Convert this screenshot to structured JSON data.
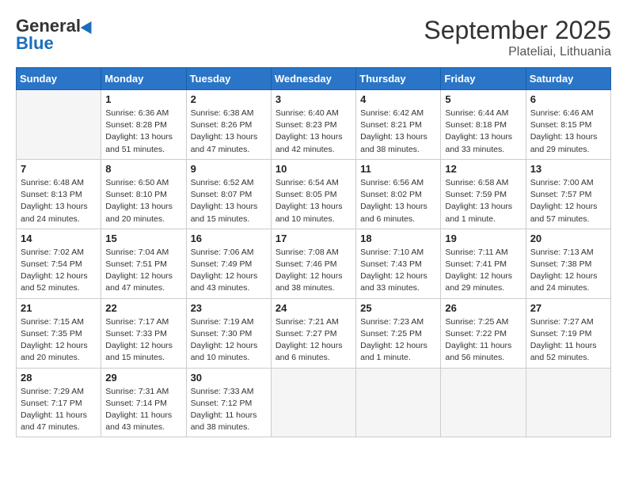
{
  "header": {
    "logo_general": "General",
    "logo_blue": "Blue",
    "month_title": "September 2025",
    "subtitle": "Plateliai, Lithuania"
  },
  "days_of_week": [
    "Sunday",
    "Monday",
    "Tuesday",
    "Wednesday",
    "Thursday",
    "Friday",
    "Saturday"
  ],
  "weeks": [
    [
      {
        "day": "",
        "info": ""
      },
      {
        "day": "1",
        "info": "Sunrise: 6:36 AM\nSunset: 8:28 PM\nDaylight: 13 hours\nand 51 minutes."
      },
      {
        "day": "2",
        "info": "Sunrise: 6:38 AM\nSunset: 8:26 PM\nDaylight: 13 hours\nand 47 minutes."
      },
      {
        "day": "3",
        "info": "Sunrise: 6:40 AM\nSunset: 8:23 PM\nDaylight: 13 hours\nand 42 minutes."
      },
      {
        "day": "4",
        "info": "Sunrise: 6:42 AM\nSunset: 8:21 PM\nDaylight: 13 hours\nand 38 minutes."
      },
      {
        "day": "5",
        "info": "Sunrise: 6:44 AM\nSunset: 8:18 PM\nDaylight: 13 hours\nand 33 minutes."
      },
      {
        "day": "6",
        "info": "Sunrise: 6:46 AM\nSunset: 8:15 PM\nDaylight: 13 hours\nand 29 minutes."
      }
    ],
    [
      {
        "day": "7",
        "info": "Sunrise: 6:48 AM\nSunset: 8:13 PM\nDaylight: 13 hours\nand 24 minutes."
      },
      {
        "day": "8",
        "info": "Sunrise: 6:50 AM\nSunset: 8:10 PM\nDaylight: 13 hours\nand 20 minutes."
      },
      {
        "day": "9",
        "info": "Sunrise: 6:52 AM\nSunset: 8:07 PM\nDaylight: 13 hours\nand 15 minutes."
      },
      {
        "day": "10",
        "info": "Sunrise: 6:54 AM\nSunset: 8:05 PM\nDaylight: 13 hours\nand 10 minutes."
      },
      {
        "day": "11",
        "info": "Sunrise: 6:56 AM\nSunset: 8:02 PM\nDaylight: 13 hours\nand 6 minutes."
      },
      {
        "day": "12",
        "info": "Sunrise: 6:58 AM\nSunset: 7:59 PM\nDaylight: 13 hours\nand 1 minute."
      },
      {
        "day": "13",
        "info": "Sunrise: 7:00 AM\nSunset: 7:57 PM\nDaylight: 12 hours\nand 57 minutes."
      }
    ],
    [
      {
        "day": "14",
        "info": "Sunrise: 7:02 AM\nSunset: 7:54 PM\nDaylight: 12 hours\nand 52 minutes."
      },
      {
        "day": "15",
        "info": "Sunrise: 7:04 AM\nSunset: 7:51 PM\nDaylight: 12 hours\nand 47 minutes."
      },
      {
        "day": "16",
        "info": "Sunrise: 7:06 AM\nSunset: 7:49 PM\nDaylight: 12 hours\nand 43 minutes."
      },
      {
        "day": "17",
        "info": "Sunrise: 7:08 AM\nSunset: 7:46 PM\nDaylight: 12 hours\nand 38 minutes."
      },
      {
        "day": "18",
        "info": "Sunrise: 7:10 AM\nSunset: 7:43 PM\nDaylight: 12 hours\nand 33 minutes."
      },
      {
        "day": "19",
        "info": "Sunrise: 7:11 AM\nSunset: 7:41 PM\nDaylight: 12 hours\nand 29 minutes."
      },
      {
        "day": "20",
        "info": "Sunrise: 7:13 AM\nSunset: 7:38 PM\nDaylight: 12 hours\nand 24 minutes."
      }
    ],
    [
      {
        "day": "21",
        "info": "Sunrise: 7:15 AM\nSunset: 7:35 PM\nDaylight: 12 hours\nand 20 minutes."
      },
      {
        "day": "22",
        "info": "Sunrise: 7:17 AM\nSunset: 7:33 PM\nDaylight: 12 hours\nand 15 minutes."
      },
      {
        "day": "23",
        "info": "Sunrise: 7:19 AM\nSunset: 7:30 PM\nDaylight: 12 hours\nand 10 minutes."
      },
      {
        "day": "24",
        "info": "Sunrise: 7:21 AM\nSunset: 7:27 PM\nDaylight: 12 hours\nand 6 minutes."
      },
      {
        "day": "25",
        "info": "Sunrise: 7:23 AM\nSunset: 7:25 PM\nDaylight: 12 hours\nand 1 minute."
      },
      {
        "day": "26",
        "info": "Sunrise: 7:25 AM\nSunset: 7:22 PM\nDaylight: 11 hours\nand 56 minutes."
      },
      {
        "day": "27",
        "info": "Sunrise: 7:27 AM\nSunset: 7:19 PM\nDaylight: 11 hours\nand 52 minutes."
      }
    ],
    [
      {
        "day": "28",
        "info": "Sunrise: 7:29 AM\nSunset: 7:17 PM\nDaylight: 11 hours\nand 47 minutes."
      },
      {
        "day": "29",
        "info": "Sunrise: 7:31 AM\nSunset: 7:14 PM\nDaylight: 11 hours\nand 43 minutes."
      },
      {
        "day": "30",
        "info": "Sunrise: 7:33 AM\nSunset: 7:12 PM\nDaylight: 11 hours\nand 38 minutes."
      },
      {
        "day": "",
        "info": ""
      },
      {
        "day": "",
        "info": ""
      },
      {
        "day": "",
        "info": ""
      },
      {
        "day": "",
        "info": ""
      }
    ]
  ]
}
